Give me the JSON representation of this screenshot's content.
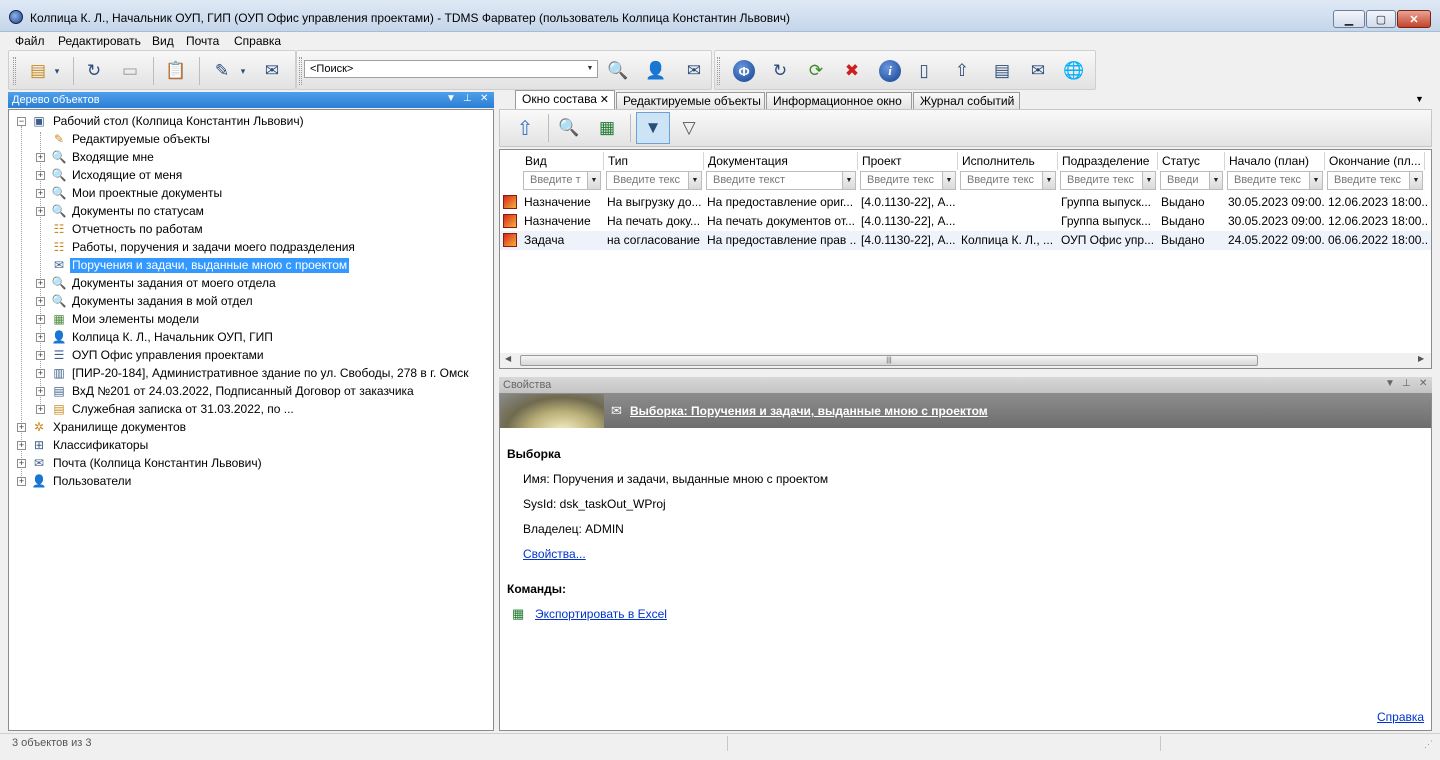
{
  "window": {
    "title": "Колпица К. Л., Начальник ОУП, ГИП (ОУП Офис управления проектами) - TDMS Фарватер (пользователь Колпица Константин Львович)",
    "minimize": "▁",
    "maximize": "▢",
    "close": "✕"
  },
  "menu": {
    "file": "Файл",
    "edit": "Редактировать",
    "view": "Вид",
    "mail": "Почта",
    "help": "Справка"
  },
  "toolbar": {
    "search_placeholder": "<Поиск>"
  },
  "tree_panel": {
    "title": "Дерево объектов",
    "items": [
      "Рабочий стол (Колпица Константин Львович)",
      "Редактируемые объекты",
      "Входящие мне",
      "Исходящие от меня",
      "Мои проектные документы",
      "Документы по статусам",
      "Отчетность по работам",
      "Работы, поручения и задачи моего подразделения",
      "Поручения и задачи, выданные мною с проектом",
      "Документы задания от моего отдела",
      "Документы задания в мой отдел",
      "Мои элементы модели",
      "Колпица К. Л., Начальник ОУП, ГИП",
      "ОУП Офис управления проектами",
      "[ПИР-20-184], Административное здание по ул. Свободы, 278 в г. Омск",
      "ВхД №201 от 24.03.2022, Подписанный Договор от заказчика",
      "Служебная записка от 31.03.2022, по ...",
      "Хранилище документов",
      "Классификаторы",
      "Почта (Колпица Константин Львович)",
      "Пользователи"
    ]
  },
  "tabs": [
    "Окно состава",
    "Редактируемые объекты",
    "Информационное окно",
    "Журнал событий"
  ],
  "grid": {
    "columns": [
      "Вид",
      "Тип",
      "Документация",
      "Проект",
      "Исполнитель",
      "Подразделение",
      "Статус",
      "Начало (план)",
      "Окончание (пл..."
    ],
    "filters": [
      "Введите т",
      "Введите текс",
      "Введите текст",
      "Введите текс",
      "Введите текс",
      "Введите текс",
      "Введи",
      "Введите текс",
      "Введите текс"
    ],
    "rows": [
      [
        "Назначение",
        "На выгрузку до...",
        "На предоставление ориг...",
        "[4.0.1130-22], А...",
        "",
        "Группа выпуск...",
        "Выдано",
        "30.05.2023 09:00...",
        "12.06.2023 18:00..."
      ],
      [
        "Назначение",
        "На печать доку...",
        "На печать документов от...",
        "[4.0.1130-22], А...",
        "",
        "Группа выпуск...",
        "Выдано",
        "30.05.2023 09:00...",
        "12.06.2023 18:00..."
      ],
      [
        "Задача",
        "на согласование",
        "На предоставление прав ...",
        "[4.0.1130-22], А...",
        "Колпица К. Л., ...",
        "ОУП Офис упр...",
        "Выдано",
        "24.05.2022 09:00...",
        "06.06.2022 18:00..."
      ]
    ]
  },
  "properties": {
    "title": "Свойства",
    "banner_link": "Выборка: Поручения и задачи, выданные мною с проектом",
    "section": "Выборка",
    "name_line": "Имя: Поручения и задачи, выданные мною с проектом",
    "sysid_line": "SysId: dsk_taskOut_WProj",
    "owner_line": "Владелец: ADMIN",
    "props_link": "Свойства...",
    "commands_label": "Команды:",
    "export_link": "Экспортировать в Excel",
    "help_link": "Справка"
  },
  "status": {
    "count": "3 объектов из 3"
  }
}
